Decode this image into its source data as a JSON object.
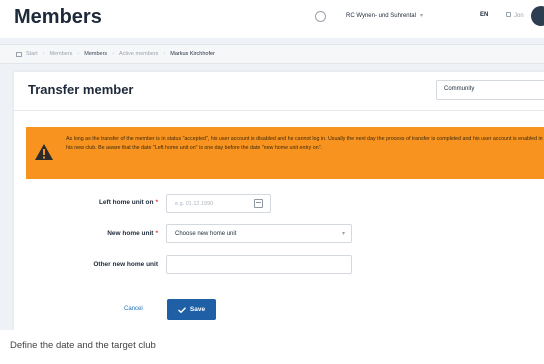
{
  "header": {
    "title": "Members",
    "club": "RC Wynen- und Suhrental",
    "language": "EN",
    "user": "Jon"
  },
  "breadcrumb": {
    "items": [
      "Start",
      "Members",
      "Members",
      "Active members",
      "Markus Kirchhofer"
    ]
  },
  "form": {
    "title": "Transfer member",
    "community_select": "Community",
    "alert_text": "As long as the transfer of the member is in status \"accepted\", his user account is disabled and he cannot log in. Usually the next day the process of transfer is completed and his user account is enabled in his new club. Be aware that the date \"Left home unit on\" is one day before the date \"new home unit entry on\".",
    "left_home_label": "Left home unit on",
    "left_home_placeholder": "e.g. 01.12.1990",
    "new_home_label": "New home unit",
    "new_home_value": "Choose new home unit",
    "other_home_label": "Other new home unit",
    "cancel_label": "Cancel",
    "save_label": "Save",
    "required_mark": "*"
  },
  "caption": "Define the date and the target club",
  "colors": {
    "alert": "#f7931e",
    "primary": "#1f5fa6",
    "link": "#1e6fb8"
  },
  "icons": [
    "globe-icon",
    "home-icon",
    "warning-icon",
    "calendar-icon",
    "check-icon",
    "chevron-down-icon"
  ]
}
